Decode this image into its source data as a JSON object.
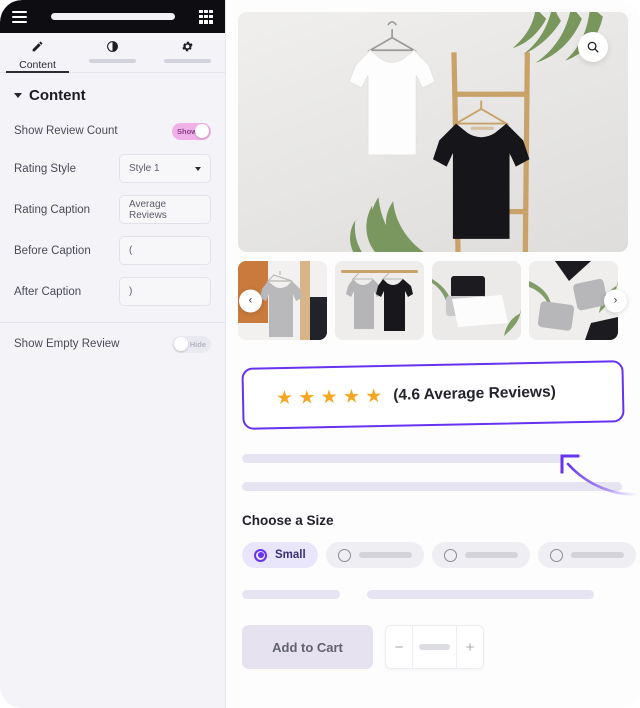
{
  "panel": {
    "topbar": {
      "menu_icon": "hamburger-icon",
      "apps_icon": "grid-apps-icon"
    },
    "tabs": [
      {
        "label": "Content",
        "icon": "pencil-icon",
        "active": true
      },
      {
        "label": "",
        "icon": "contrast-half-circle-icon",
        "active": false
      },
      {
        "label": "",
        "icon": "gear-icon",
        "active": false
      }
    ],
    "section": {
      "title": "Content",
      "caret_icon": "caret-down-icon"
    },
    "controls": [
      {
        "label": "Show Review Count",
        "type": "toggle",
        "state": "on",
        "state_label": "Show"
      },
      {
        "label": "Rating Style",
        "type": "select",
        "value": "Style 1"
      },
      {
        "label": "Rating Caption",
        "type": "text",
        "value": "Average Reviews"
      },
      {
        "label": "Before Caption",
        "type": "text",
        "value": "("
      },
      {
        "label": "After Caption",
        "type": "text",
        "value": ")"
      },
      {
        "label": "Show Empty Review",
        "type": "toggle",
        "state": "off",
        "state_label": "Hide"
      }
    ]
  },
  "preview": {
    "hero": {
      "zoom_icon": "magnifier-icon",
      "alt": "white and black t-shirts on hangers"
    },
    "gallery": {
      "prev_icon": "chevron-left-icon",
      "next_icon": "chevron-right-icon",
      "thumbnails": [
        "gray t-shirt on hanger",
        "gray and black t-shirts on rail",
        "folded white and black t-shirts",
        "folded gray t-shirts flat lay"
      ]
    },
    "rating": {
      "stars": "★ ★ ★ ★ ★",
      "star_count": 5,
      "value": 4.6,
      "text": "(4.6 Average Reviews)",
      "highlight_color": "#6633f0",
      "star_color": "#f5a623"
    },
    "size": {
      "title": "Choose a Size",
      "options": [
        {
          "label": "Small",
          "selected": true
        },
        {
          "label": "",
          "selected": false
        },
        {
          "label": "",
          "selected": false
        },
        {
          "label": "",
          "selected": false
        }
      ]
    },
    "cart": {
      "button_label": "Add to Cart",
      "decrement_label": "−",
      "increment_label": "+"
    }
  }
}
